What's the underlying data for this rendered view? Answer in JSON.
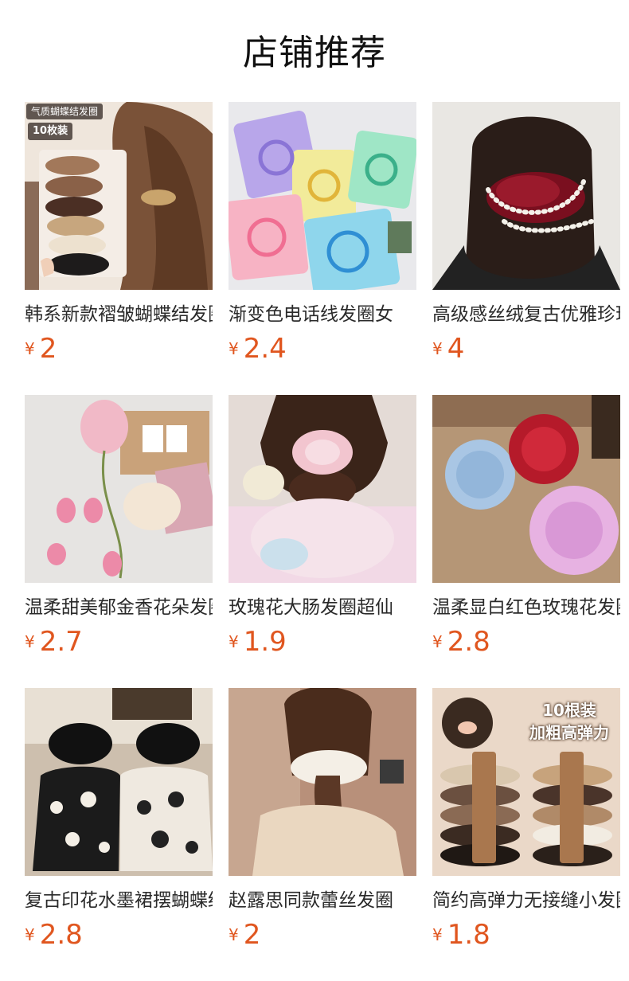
{
  "page": {
    "title": "店铺推荐"
  },
  "currency": "¥",
  "products": [
    {
      "name": "韩系新款褶皱蝴蝶结发圈",
      "price": "2",
      "badge": "气质蝴蝶结发圈",
      "badge2": "10枚装",
      "icon": "bow-scrunchie-photo"
    },
    {
      "name": "渐变色电话线发圈女",
      "price": "2.4",
      "icon": "coil-hair-tie-photo"
    },
    {
      "name": "高级感丝绒复古优雅珍珠发圈",
      "price": "4",
      "icon": "velvet-pearl-scrunchie-photo"
    },
    {
      "name": "温柔甜美郁金香花朵发圈",
      "price": "2.7",
      "icon": "tulip-scrunchie-photo"
    },
    {
      "name": "玫瑰花大肠发圈超仙",
      "price": "1.9",
      "icon": "rose-scrunchie-photo"
    },
    {
      "name": "温柔显白红色玫瑰花发圈",
      "price": "2.8",
      "icon": "lace-rose-scrunchie-photo"
    },
    {
      "name": "复古印花水墨裙摆蝴蝶结发圈",
      "price": "2.8",
      "icon": "ink-print-ribbon-scrunchie-photo"
    },
    {
      "name": "赵露思同款蕾丝发圈",
      "price": "2",
      "icon": "lace-scrunchie-braid-photo"
    },
    {
      "name": "简约高弹力无接缝小发圈",
      "price": "1.8",
      "overlay1": "10根装",
      "overlay2": "加粗高弹力",
      "icon": "elastic-band-pack-photo"
    }
  ]
}
